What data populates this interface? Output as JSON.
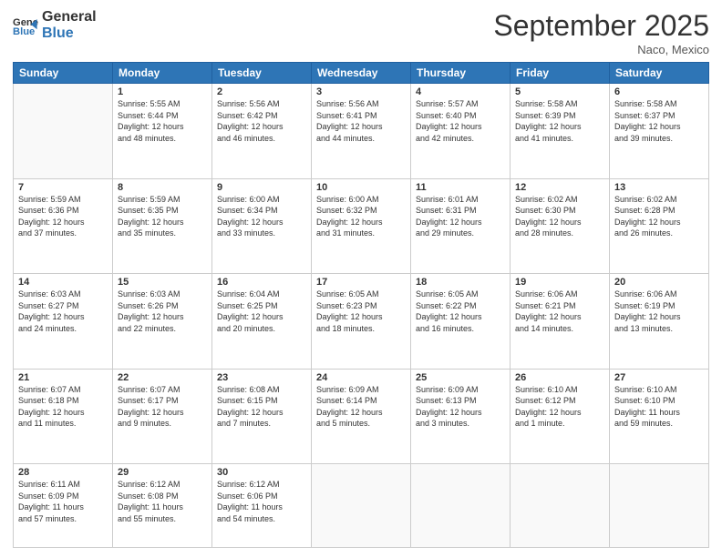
{
  "header": {
    "logo_general": "General",
    "logo_blue": "Blue",
    "month_title": "September 2025",
    "location": "Naco, Mexico"
  },
  "days_of_week": [
    "Sunday",
    "Monday",
    "Tuesday",
    "Wednesday",
    "Thursday",
    "Friday",
    "Saturday"
  ],
  "weeks": [
    [
      {
        "day": "",
        "info": ""
      },
      {
        "day": "1",
        "info": "Sunrise: 5:55 AM\nSunset: 6:44 PM\nDaylight: 12 hours\nand 48 minutes."
      },
      {
        "day": "2",
        "info": "Sunrise: 5:56 AM\nSunset: 6:42 PM\nDaylight: 12 hours\nand 46 minutes."
      },
      {
        "day": "3",
        "info": "Sunrise: 5:56 AM\nSunset: 6:41 PM\nDaylight: 12 hours\nand 44 minutes."
      },
      {
        "day": "4",
        "info": "Sunrise: 5:57 AM\nSunset: 6:40 PM\nDaylight: 12 hours\nand 42 minutes."
      },
      {
        "day": "5",
        "info": "Sunrise: 5:58 AM\nSunset: 6:39 PM\nDaylight: 12 hours\nand 41 minutes."
      },
      {
        "day": "6",
        "info": "Sunrise: 5:58 AM\nSunset: 6:37 PM\nDaylight: 12 hours\nand 39 minutes."
      }
    ],
    [
      {
        "day": "7",
        "info": "Sunrise: 5:59 AM\nSunset: 6:36 PM\nDaylight: 12 hours\nand 37 minutes."
      },
      {
        "day": "8",
        "info": "Sunrise: 5:59 AM\nSunset: 6:35 PM\nDaylight: 12 hours\nand 35 minutes."
      },
      {
        "day": "9",
        "info": "Sunrise: 6:00 AM\nSunset: 6:34 PM\nDaylight: 12 hours\nand 33 minutes."
      },
      {
        "day": "10",
        "info": "Sunrise: 6:00 AM\nSunset: 6:32 PM\nDaylight: 12 hours\nand 31 minutes."
      },
      {
        "day": "11",
        "info": "Sunrise: 6:01 AM\nSunset: 6:31 PM\nDaylight: 12 hours\nand 29 minutes."
      },
      {
        "day": "12",
        "info": "Sunrise: 6:02 AM\nSunset: 6:30 PM\nDaylight: 12 hours\nand 28 minutes."
      },
      {
        "day": "13",
        "info": "Sunrise: 6:02 AM\nSunset: 6:28 PM\nDaylight: 12 hours\nand 26 minutes."
      }
    ],
    [
      {
        "day": "14",
        "info": "Sunrise: 6:03 AM\nSunset: 6:27 PM\nDaylight: 12 hours\nand 24 minutes."
      },
      {
        "day": "15",
        "info": "Sunrise: 6:03 AM\nSunset: 6:26 PM\nDaylight: 12 hours\nand 22 minutes."
      },
      {
        "day": "16",
        "info": "Sunrise: 6:04 AM\nSunset: 6:25 PM\nDaylight: 12 hours\nand 20 minutes."
      },
      {
        "day": "17",
        "info": "Sunrise: 6:05 AM\nSunset: 6:23 PM\nDaylight: 12 hours\nand 18 minutes."
      },
      {
        "day": "18",
        "info": "Sunrise: 6:05 AM\nSunset: 6:22 PM\nDaylight: 12 hours\nand 16 minutes."
      },
      {
        "day": "19",
        "info": "Sunrise: 6:06 AM\nSunset: 6:21 PM\nDaylight: 12 hours\nand 14 minutes."
      },
      {
        "day": "20",
        "info": "Sunrise: 6:06 AM\nSunset: 6:19 PM\nDaylight: 12 hours\nand 13 minutes."
      }
    ],
    [
      {
        "day": "21",
        "info": "Sunrise: 6:07 AM\nSunset: 6:18 PM\nDaylight: 12 hours\nand 11 minutes."
      },
      {
        "day": "22",
        "info": "Sunrise: 6:07 AM\nSunset: 6:17 PM\nDaylight: 12 hours\nand 9 minutes."
      },
      {
        "day": "23",
        "info": "Sunrise: 6:08 AM\nSunset: 6:15 PM\nDaylight: 12 hours\nand 7 minutes."
      },
      {
        "day": "24",
        "info": "Sunrise: 6:09 AM\nSunset: 6:14 PM\nDaylight: 12 hours\nand 5 minutes."
      },
      {
        "day": "25",
        "info": "Sunrise: 6:09 AM\nSunset: 6:13 PM\nDaylight: 12 hours\nand 3 minutes."
      },
      {
        "day": "26",
        "info": "Sunrise: 6:10 AM\nSunset: 6:12 PM\nDaylight: 12 hours\nand 1 minute."
      },
      {
        "day": "27",
        "info": "Sunrise: 6:10 AM\nSunset: 6:10 PM\nDaylight: 11 hours\nand 59 minutes."
      }
    ],
    [
      {
        "day": "28",
        "info": "Sunrise: 6:11 AM\nSunset: 6:09 PM\nDaylight: 11 hours\nand 57 minutes."
      },
      {
        "day": "29",
        "info": "Sunrise: 6:12 AM\nSunset: 6:08 PM\nDaylight: 11 hours\nand 55 minutes."
      },
      {
        "day": "30",
        "info": "Sunrise: 6:12 AM\nSunset: 6:06 PM\nDaylight: 11 hours\nand 54 minutes."
      },
      {
        "day": "",
        "info": ""
      },
      {
        "day": "",
        "info": ""
      },
      {
        "day": "",
        "info": ""
      },
      {
        "day": "",
        "info": ""
      }
    ]
  ]
}
